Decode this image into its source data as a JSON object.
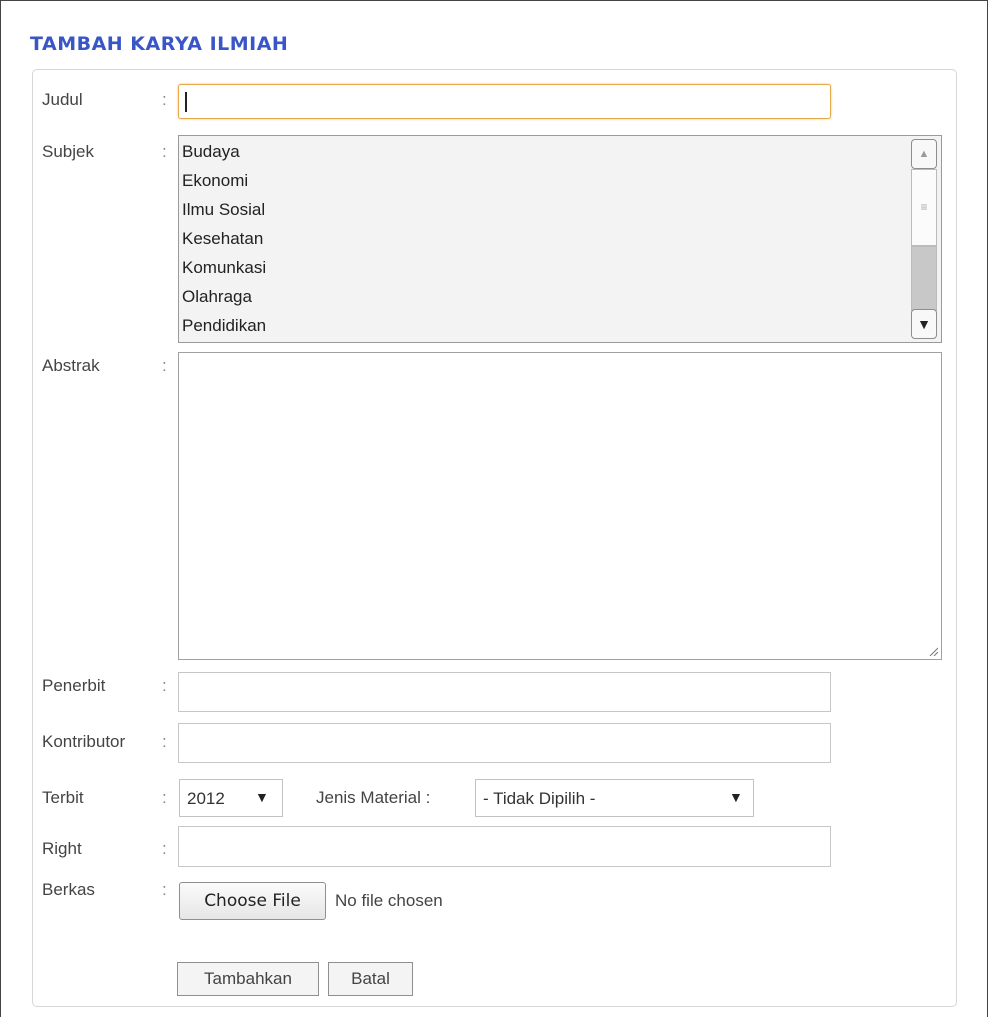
{
  "page_title": "TAMBAH KARYA ILMIAH",
  "form": {
    "judul": {
      "label": "Judul",
      "value": ""
    },
    "subjek": {
      "label": "Subjek",
      "options": [
        "Budaya",
        "Ekonomi",
        "Ilmu Sosial",
        "Kesehatan",
        "Komunkasi",
        "Olahraga",
        "Pendidikan"
      ]
    },
    "abstrak": {
      "label": "Abstrak",
      "value": ""
    },
    "penerbit": {
      "label": "Penerbit",
      "value": ""
    },
    "kontributor": {
      "label": "Kontributor",
      "value": ""
    },
    "terbit": {
      "label": "Terbit",
      "value": "2012"
    },
    "jenis_material": {
      "label": "Jenis Material :",
      "value": "- Tidak Dipilih -"
    },
    "right": {
      "label": "Right",
      "value": ""
    },
    "berkas": {
      "label": "Berkas",
      "button": "Choose File",
      "status": "No file chosen"
    },
    "colon": ":"
  },
  "actions": {
    "submit": "Tambahkan",
    "cancel": "Batal"
  },
  "icons": {
    "scroll_up": "scroll-up-icon",
    "scroll_down": "scroll-down-icon",
    "dropdown": "dropdown-arrow-icon",
    "resize": "resize-grip-icon"
  },
  "colors": {
    "title": "#3a56c6",
    "focus": "#e3a94b"
  }
}
